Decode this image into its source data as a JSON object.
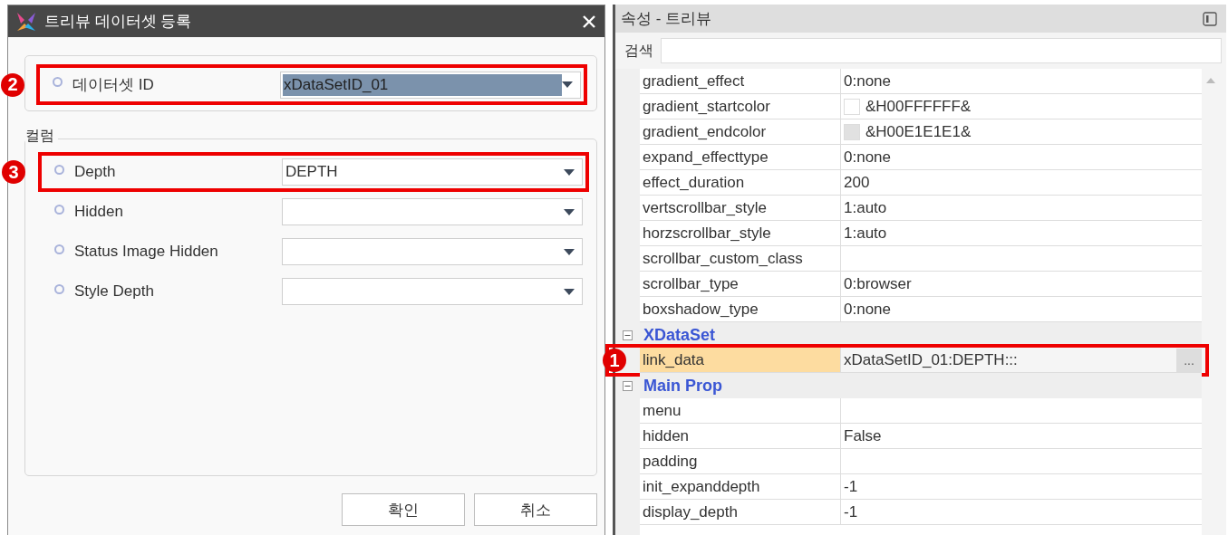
{
  "dialog": {
    "title": "트리뷰 데이터셋 등록",
    "dataset_field": {
      "label": "데이터셋 ID",
      "value": "xDataSetID_01",
      "text_selected": true,
      "callout": "2"
    },
    "columns_group": {
      "title": "컬럼",
      "fields": [
        {
          "label": "Depth",
          "value": "DEPTH",
          "callout": "3"
        },
        {
          "label": "Hidden"
        },
        {
          "label": "Status Image Hidden"
        },
        {
          "label": "Style Depth"
        }
      ]
    },
    "buttons": [
      "확인",
      "취소"
    ]
  },
  "properties": {
    "title": "속성 - 트리뷰",
    "search": {
      "label": "검색"
    },
    "rows": [
      {
        "kind": "property",
        "name": "gradient_effect",
        "value": "0:none",
        "selected": false
      },
      {
        "kind": "swatch",
        "name": "gradient_startcolor",
        "value": "&H00FFFFFF&",
        "color": "#ffffff",
        "selected": false
      },
      {
        "kind": "swatch",
        "name": "gradient_endcolor",
        "value": "&H00E1E1E1&",
        "color": "#e1e1e1",
        "selected": false
      },
      {
        "kind": "property",
        "name": "expand_effecttype",
        "value": "0:none",
        "selected": false
      },
      {
        "kind": "property",
        "name": "effect_duration",
        "value": "200",
        "selected": false
      },
      {
        "kind": "property",
        "name": "vertscrollbar_style",
        "value": "1:auto",
        "selected": false
      },
      {
        "kind": "property",
        "name": "horzscrollbar_style",
        "value": "1:auto",
        "selected": false
      },
      {
        "kind": "property",
        "name": "scrollbar_custom_class",
        "selected": false
      },
      {
        "kind": "property",
        "name": "scrollbar_type",
        "value": "0:browser",
        "selected": false
      },
      {
        "kind": "property",
        "name": "boxshadow_type",
        "value": "0:none",
        "selected": false
      },
      {
        "kind": "group",
        "name": "XDataSet",
        "expanded": true
      },
      {
        "kind": "property",
        "name": "link_data",
        "value": "xDataSetID_01:DEPTH:::",
        "selected": true,
        "callout": "1",
        "button_label": "..."
      },
      {
        "kind": "group",
        "name": "Main Prop",
        "expanded": true
      },
      {
        "kind": "property",
        "name": "menu",
        "selected": false
      },
      {
        "kind": "property",
        "name": "hidden",
        "value": "False",
        "selected": false
      },
      {
        "kind": "property",
        "name": "padding",
        "selected": false
      },
      {
        "kind": "property",
        "name": "init_expanddepth",
        "value": "-1",
        "selected": false
      },
      {
        "kind": "property",
        "name": "display_depth",
        "value": "-1",
        "selected": false
      }
    ]
  }
}
